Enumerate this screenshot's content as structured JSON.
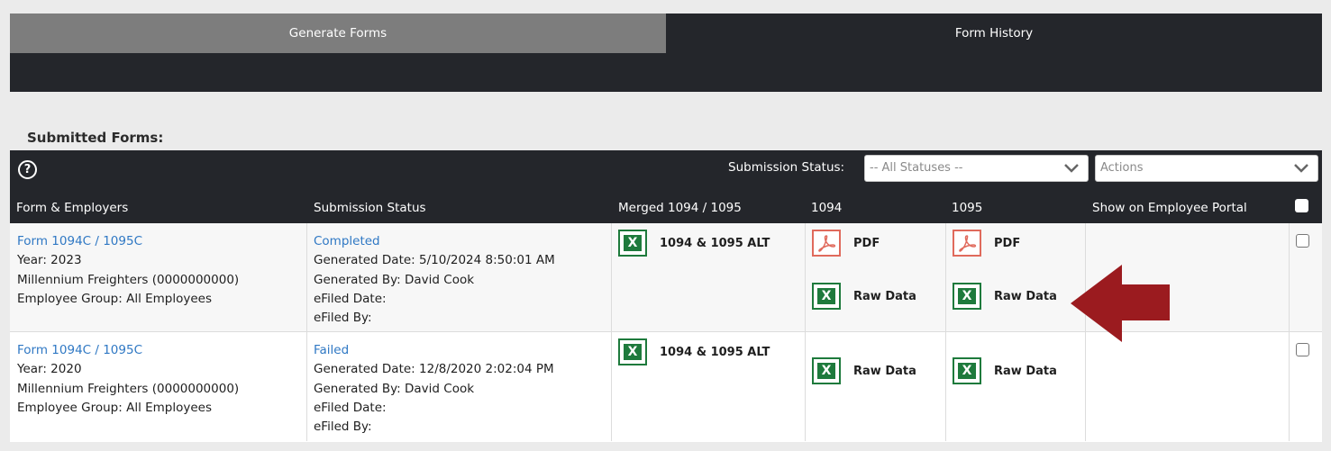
{
  "tabs": [
    {
      "label": "Generate Forms"
    },
    {
      "label": "Form History"
    }
  ],
  "section_title": "Submitted Forms:",
  "toolbar": {
    "help_icon": "?",
    "status_label": "Submission Status:",
    "status_select": "-- All Statuses --",
    "actions_select": "Actions"
  },
  "columns": [
    "Form & Employers",
    "Submission Status",
    "Merged 1094 / 1095",
    "1094",
    "1095",
    "Show on Employee Portal"
  ],
  "rows": [
    {
      "form": "Form 1094C / 1095C",
      "year": "Year: 2023",
      "employer": "Millennium Freighters (0000000000)",
      "group": "Employee Group: All Employees",
      "status": "Completed",
      "generated_date": "Generated Date: 5/10/2024 8:50:01 AM",
      "generated_by": "Generated By: David Cook",
      "efiled_date": "eFiled Date:",
      "efiled_by": "eFiled By:",
      "merged": "1094 & 1095 ALT",
      "f1094_pdf": "PDF",
      "f1094_raw": "Raw Data",
      "f1095_pdf": "PDF",
      "f1095_raw": "Raw Data"
    },
    {
      "form": "Form 1094C / 1095C",
      "year": "Year: 2020",
      "employer": "Millennium Freighters (0000000000)",
      "group": "Employee Group: All Employees",
      "status": "Failed",
      "generated_date": "Generated Date: 12/8/2020 2:02:04 PM",
      "generated_by": "Generated By: David Cook",
      "efiled_date": "eFiled Date:",
      "efiled_by": "eFiled By:",
      "merged": "1094 & 1095 ALT",
      "f1094_raw": "Raw Data",
      "f1095_raw": "Raw Data"
    }
  ],
  "icons": {
    "excel": "X",
    "pdf": "pdf-icon",
    "excel_color": "#1e7a3c",
    "pdf_color": "#e06a5c",
    "arrow_color": "#9b1b1f"
  }
}
